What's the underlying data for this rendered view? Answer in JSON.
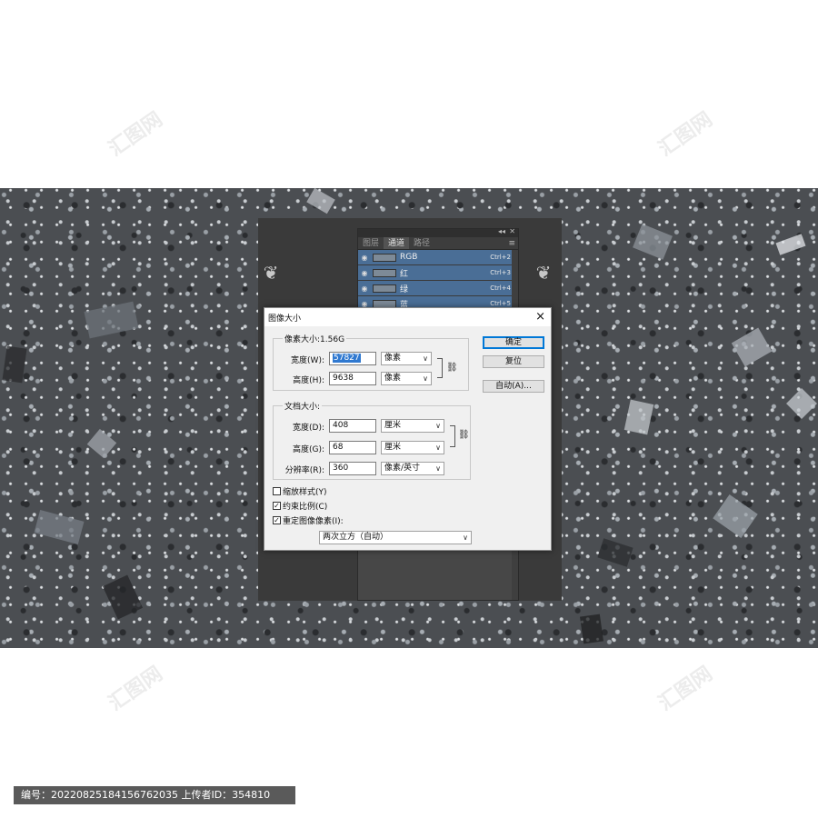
{
  "channels_panel": {
    "collapse_glyph": "◂◂",
    "close_glyph": "✕",
    "menu_glyph": "≡",
    "tabs": [
      {
        "label": "图层",
        "active": false
      },
      {
        "label": "通道",
        "active": true
      },
      {
        "label": "路径",
        "active": false
      }
    ],
    "channels": [
      {
        "name": "RGB",
        "shortcut": "Ctrl+2"
      },
      {
        "name": "红",
        "shortcut": "Ctrl+3"
      },
      {
        "name": "绿",
        "shortcut": "Ctrl+4"
      },
      {
        "name": "蓝",
        "shortcut": "Ctrl+5"
      }
    ]
  },
  "dialog": {
    "title": "图像大小",
    "close": "×",
    "pixel_group": {
      "label": "像素大小:1.56G",
      "width_label": "宽度(W):",
      "width_value": "57827",
      "width_unit": "像素",
      "height_label": "高度(H):",
      "height_value": "9638",
      "height_unit": "像素"
    },
    "doc_group": {
      "label": "文档大小:",
      "width_label": "宽度(D):",
      "width_value": "408",
      "width_unit": "厘米",
      "height_label": "高度(G):",
      "height_value": "68",
      "height_unit": "厘米",
      "res_label": "分辨率(R):",
      "res_value": "360",
      "res_unit": "像素/英寸"
    },
    "buttons": {
      "ok": "确定",
      "reset": "复位",
      "auto": "自动(A)..."
    },
    "options": {
      "scale_styles": {
        "label": "缩放样式(Y)",
        "checked": false
      },
      "constrain": {
        "label": "约束比例(C)",
        "checked": true
      },
      "resample": {
        "label": "重定图像像素(I):",
        "checked": true
      }
    },
    "resample_method": "两次立方（自动）"
  },
  "footer": {
    "text": "编号：20220825184156762035 上传者ID：354810"
  },
  "watermark_text": "汇图网"
}
